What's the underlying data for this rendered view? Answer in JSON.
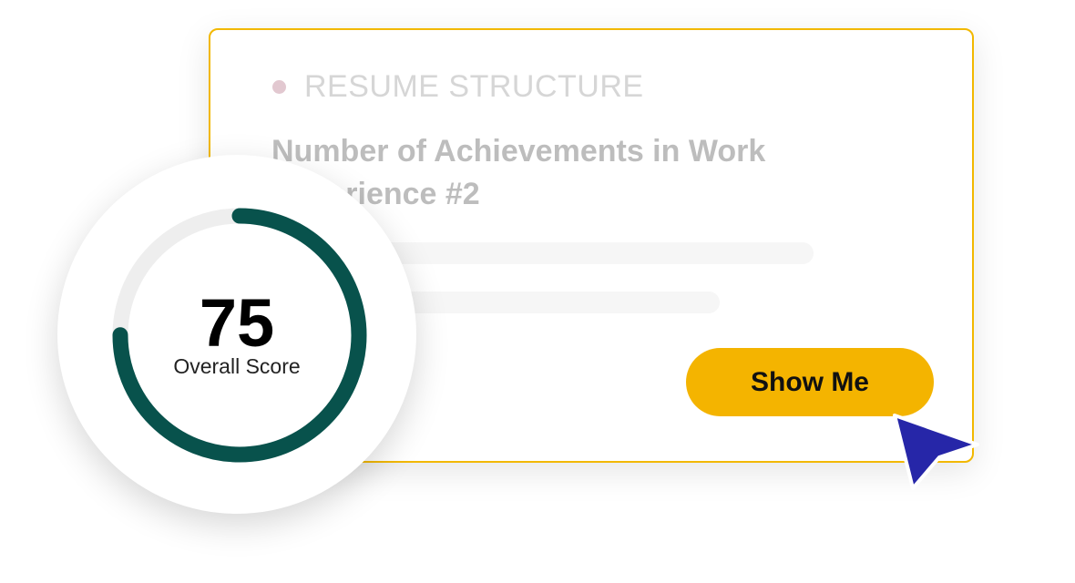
{
  "card": {
    "category": "RESUME STRUCTURE",
    "title": "Number of Achievements in Work Experience #2",
    "button_label": "Show Me"
  },
  "score": {
    "value": "75",
    "label": "Overall Score",
    "progress_fraction": 0.75
  },
  "colors": {
    "accent": "#f4b400",
    "card_border": "#f2b800",
    "ring": "#08524c",
    "ring_track": "#eeeeee",
    "cursor": "#2626a8"
  },
  "icons": {
    "cursor": "cursor-pointer-icon",
    "category_dot": "dot-icon"
  }
}
